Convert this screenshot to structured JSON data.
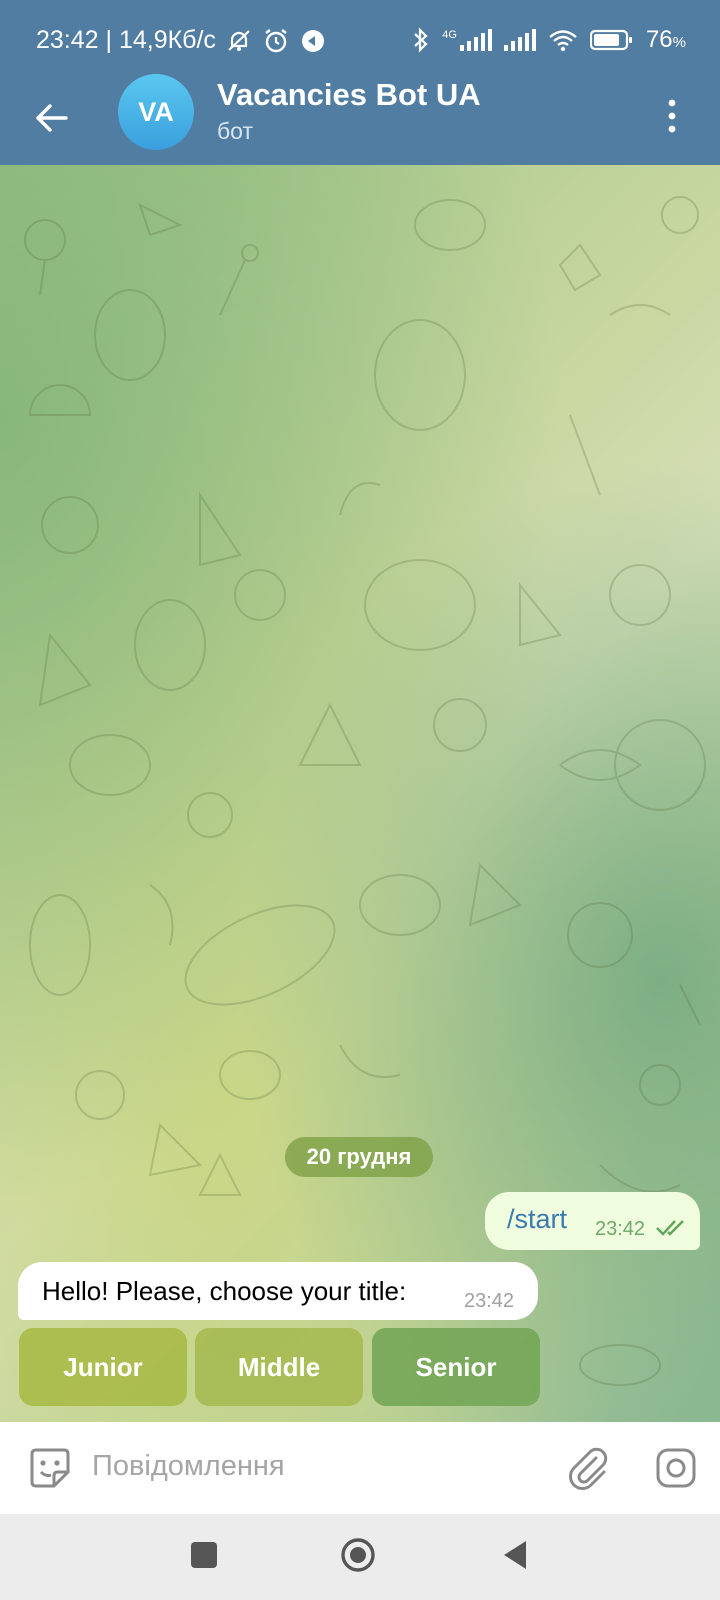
{
  "status_bar": {
    "time_and_speed": "23:42 | 14,9Кб/с",
    "network_label": "4G",
    "battery": "76",
    "battery_unit": "%"
  },
  "header": {
    "avatar_initials": "VA",
    "title": "Vacancies Bot UA",
    "subtitle": "бот"
  },
  "chat": {
    "date_label": "20 грудня",
    "messages": [
      {
        "direction": "outgoing",
        "text": "/start",
        "time": "23:42",
        "status": "read"
      },
      {
        "direction": "incoming",
        "text": "Hello! Please, choose your title:",
        "time": "23:42"
      }
    ],
    "keyboard": [
      {
        "label": "Junior"
      },
      {
        "label": "Middle"
      },
      {
        "label": "Senior"
      }
    ]
  },
  "composer": {
    "placeholder": "Повідомлення"
  },
  "colors": {
    "header_bg": "#517da2",
    "outgoing_bubble": "#effdde",
    "incoming_bubble": "#ffffff",
    "keyboard_button": "#a8ba46"
  }
}
